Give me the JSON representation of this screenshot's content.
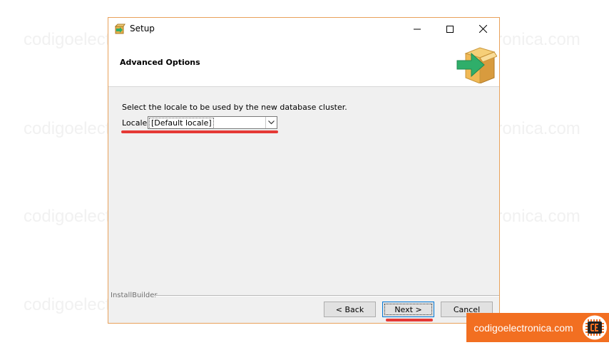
{
  "watermark": "codigoelectronica.com",
  "window": {
    "title": "Setup",
    "controls": {
      "minimize": "minimize-icon",
      "maximize": "maximize-icon",
      "close": "close-icon"
    }
  },
  "header": {
    "title": "Advanced Options",
    "logo_icon": "install-box-arrow-icon"
  },
  "content": {
    "description": "Select the locale to be used by the new database cluster.",
    "locale_label": "Locale",
    "locale_value": "[Default locale]"
  },
  "footer": {
    "installer_label": "InstallBuilder",
    "back_label": "< Back",
    "next_label": "Next >",
    "cancel_label": "Cancel"
  },
  "brand": {
    "text": "codigoelectronica.com",
    "color": "#f26f21",
    "logo_icon": "chip-ce-icon"
  },
  "colors": {
    "window_border": "#e8a15a",
    "highlight_underline": "#e53935"
  }
}
